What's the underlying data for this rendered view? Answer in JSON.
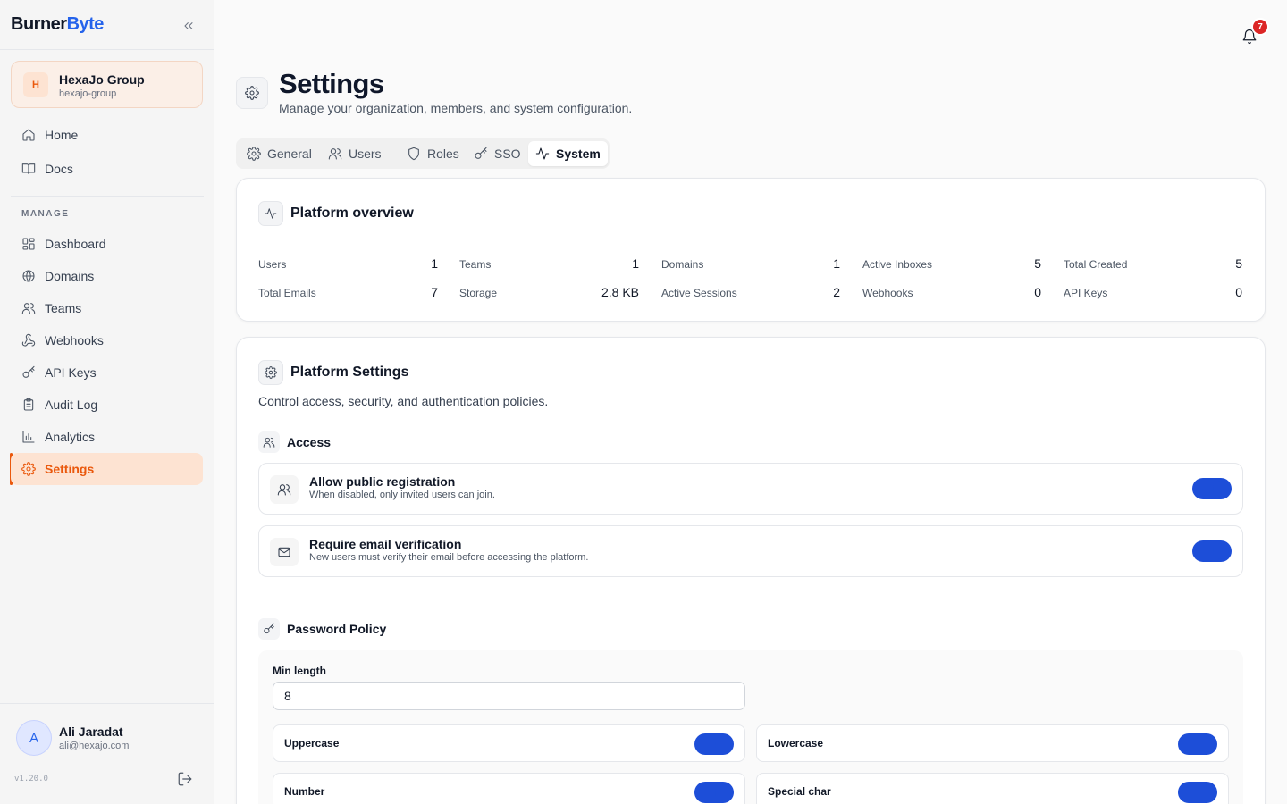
{
  "brand": {
    "part1": "Burner",
    "part2": "Byte",
    "color_accent": "#2563eb"
  },
  "org": {
    "initial": "H",
    "name": "HexaJo Group",
    "slug": "hexajo-group"
  },
  "nav_top": [
    {
      "label": "Home",
      "icon": "home-icon"
    },
    {
      "label": "Docs",
      "icon": "book-icon"
    }
  ],
  "manage_label": "MANAGE",
  "nav_manage": [
    {
      "label": "Dashboard",
      "icon": "dashboard-icon"
    },
    {
      "label": "Domains",
      "icon": "globe-icon"
    },
    {
      "label": "Teams",
      "icon": "users-icon"
    },
    {
      "label": "Webhooks",
      "icon": "webhook-icon"
    },
    {
      "label": "API Keys",
      "icon": "key-icon"
    },
    {
      "label": "Audit Log",
      "icon": "clipboard-icon"
    },
    {
      "label": "Analytics",
      "icon": "bar-chart-icon"
    },
    {
      "label": "Settings",
      "icon": "gear-icon",
      "active": true
    }
  ],
  "user": {
    "initial": "A",
    "name": "Ali Jaradat",
    "email": "ali@hexajo.com"
  },
  "version": "v1.20.0",
  "notifications": {
    "count": "7"
  },
  "header": {
    "title": "Settings",
    "subtitle": "Manage your organization, members, and system configuration."
  },
  "tabs": [
    {
      "label": "General",
      "icon": "gear-icon"
    },
    {
      "label": "Users",
      "icon": "users-icon"
    },
    {
      "label": "Roles",
      "icon": "shield-icon"
    },
    {
      "label": "SSO",
      "icon": "key-icon"
    },
    {
      "label": "System",
      "icon": "activity-icon",
      "active": true
    }
  ],
  "overview": {
    "title": "Platform overview",
    "stats": [
      {
        "label": "Users",
        "value": "1"
      },
      {
        "label": "Teams",
        "value": "1"
      },
      {
        "label": "Domains",
        "value": "1"
      },
      {
        "label": "Active Inboxes",
        "value": "5"
      },
      {
        "label": "Total Created",
        "value": "5"
      },
      {
        "label": "Total Emails",
        "value": "7"
      },
      {
        "label": "Storage",
        "value": "2.8 KB"
      },
      {
        "label": "Active Sessions",
        "value": "2"
      },
      {
        "label": "Webhooks",
        "value": "0"
      },
      {
        "label": "API Keys",
        "value": "0"
      }
    ]
  },
  "platform_settings": {
    "title": "Platform Settings",
    "description": "Control access, security, and authentication policies.",
    "access": {
      "title": "Access",
      "items": [
        {
          "title": "Allow public registration",
          "desc": "When disabled, only invited users can join.",
          "enabled": true
        },
        {
          "title": "Require email verification",
          "desc": "New users must verify their email before accessing the platform.",
          "enabled": true
        }
      ]
    },
    "password_policy": {
      "title": "Password Policy",
      "min_length_label": "Min length",
      "min_length_value": "8",
      "rules": [
        {
          "label": "Uppercase",
          "enabled": true
        },
        {
          "label": "Lowercase",
          "enabled": true
        },
        {
          "label": "Number",
          "enabled": true
        },
        {
          "label": "Special char",
          "enabled": true
        }
      ]
    }
  },
  "colors": {
    "primary": "#1d4ed8",
    "accent_orange": "#ea580c",
    "badge_red": "#dc2626"
  }
}
